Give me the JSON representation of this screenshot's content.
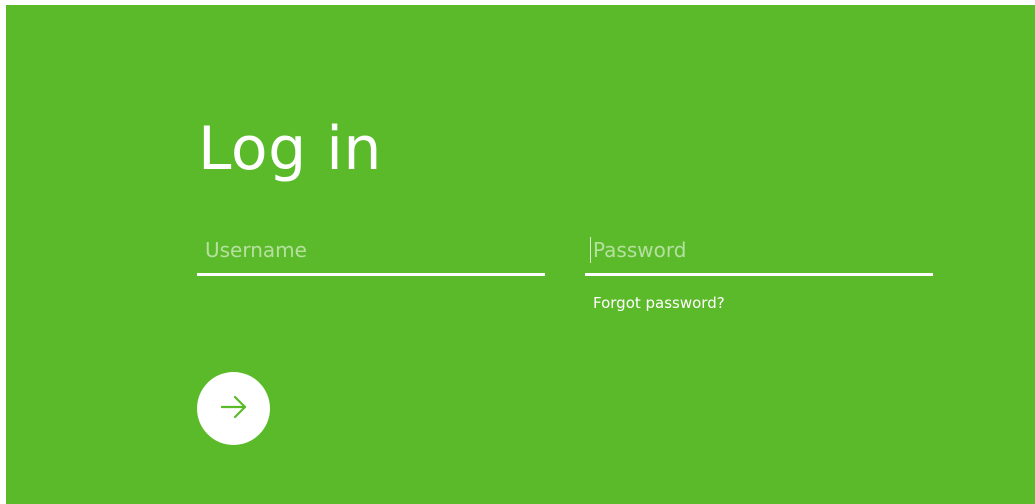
{
  "login": {
    "title": "Log in",
    "username_placeholder": "Username",
    "username_value": "",
    "password_placeholder": "Password",
    "password_value": "",
    "forgot_password_label": "Forgot password?",
    "submit_icon": "arrow-right-icon"
  },
  "colors": {
    "background": "#5bba2a",
    "foreground": "#ffffff",
    "accent": "#5bba2a"
  }
}
